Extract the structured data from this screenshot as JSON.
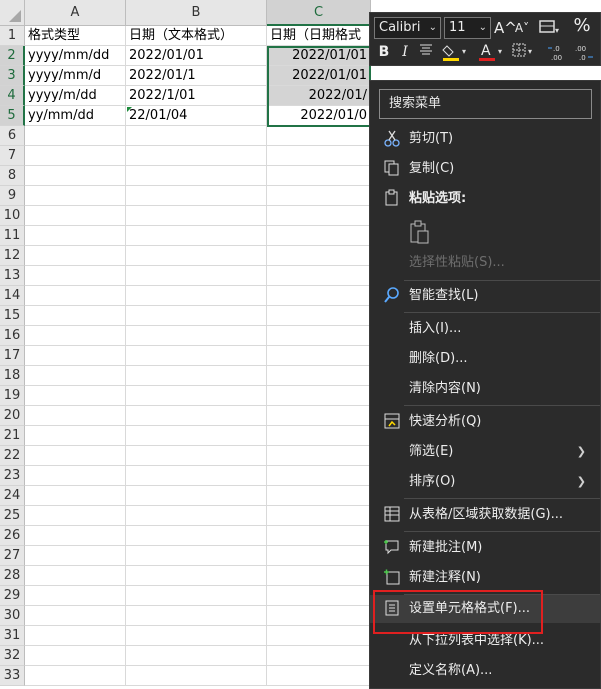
{
  "sheet": {
    "columns": [
      "A",
      "B",
      "C"
    ],
    "rows": [
      "1",
      "2",
      "3",
      "4",
      "5",
      "6",
      "7",
      "8",
      "9",
      "10",
      "11",
      "12",
      "13",
      "14",
      "15",
      "16",
      "17",
      "18",
      "19",
      "20",
      "21",
      "22",
      "23",
      "24",
      "25",
      "26",
      "27",
      "28",
      "29",
      "30",
      "31",
      "32",
      "33"
    ],
    "header_row": [
      "格式类型",
      "日期（文本格式）",
      "日期（日期格式"
    ],
    "data": [
      [
        "yyyy/mm/dd",
        "2022/01/01",
        "2022/01/01"
      ],
      [
        "yyyy/mm/d",
        "2022/01/1",
        "2022/01/01"
      ],
      [
        "yyyy/m/dd",
        "2022/1/01",
        "2022/01/"
      ],
      [
        "yy/mm/dd",
        "22/01/04",
        "2022/01/0"
      ]
    ]
  },
  "mini_toolbar": {
    "font": "Calibri",
    "size": "11",
    "grow_font": "A^",
    "shrink_font": "A˅",
    "percent": "%",
    "bold": "B",
    "italic": "I",
    "font_color_glyph": "A",
    "dec_inc": "←.0 .00",
    "dec_dec": ".00 →.0",
    "accent_yellow": "#ffd800",
    "accent_red": "#e02020"
  },
  "context_menu": {
    "search_placeholder": "搜索菜单",
    "items": [
      {
        "label": "剪切(T)",
        "icon": "scissors-icon"
      },
      {
        "label": "复制(C)",
        "icon": "copy-icon"
      },
      {
        "label": "粘贴选项:",
        "icon": "paste-icon"
      },
      {
        "label": "选择性粘贴(S)...",
        "icon": "",
        "disabled": true
      },
      {
        "label": "智能查找(L)",
        "icon": "smart-lookup-icon"
      },
      {
        "label": "插入(I)...",
        "icon": ""
      },
      {
        "label": "删除(D)...",
        "icon": ""
      },
      {
        "label": "清除内容(N)",
        "icon": ""
      },
      {
        "label": "快速分析(Q)",
        "icon": "quick-analysis-icon"
      },
      {
        "label": "筛选(E)",
        "icon": "",
        "submenu": true
      },
      {
        "label": "排序(O)",
        "icon": "",
        "submenu": true
      },
      {
        "label": "从表格/区域获取数据(G)...",
        "icon": "table-icon"
      },
      {
        "label": "新建批注(M)",
        "icon": "new-comment-icon"
      },
      {
        "label": "新建注释(N)",
        "icon": "new-note-icon"
      },
      {
        "label": "设置单元格格式(F)...",
        "icon": "format-cells-icon"
      },
      {
        "label": "从下拉列表中选择(K)...",
        "icon": ""
      },
      {
        "label": "定义名称(A)...",
        "icon": ""
      }
    ]
  }
}
